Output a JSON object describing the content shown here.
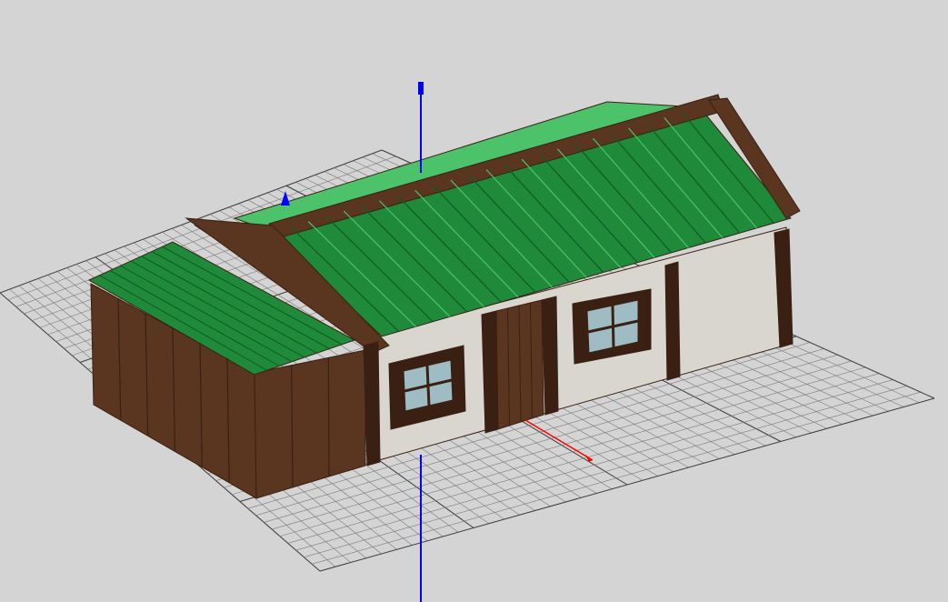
{
  "viewport": {
    "background": "#d4d4d4",
    "grid_color": "#7a7a7a",
    "grid_color_heavy": "#3a3a3a"
  },
  "axes": {
    "z_color": "#0000ff",
    "x_color": "#ff0000"
  },
  "model": {
    "roof_color": "#1f8a3a",
    "roof_dark": "#0f5a22",
    "roof_light": "#4cc36a",
    "wood_color": "#5a3520",
    "wood_dark": "#3a2012",
    "wall_color": "#d9d6d0",
    "window_glass": "#9fbcc4"
  }
}
